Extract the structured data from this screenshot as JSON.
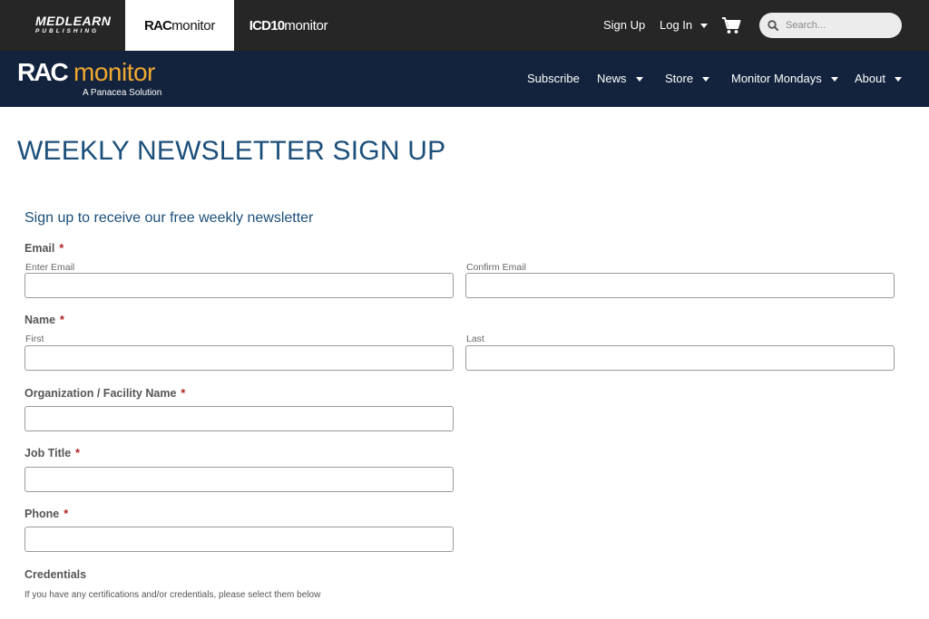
{
  "topbar": {
    "medlearn_main": "MEDLEARN",
    "medlearn_sub": "PUBLISHING",
    "tab_rac_bold": "RAC",
    "tab_rac_light": "monitor",
    "tab_icd_bold": "ICD10",
    "tab_icd_light": "monitor",
    "signup": "Sign Up",
    "login": "Log In",
    "search_placeholder": "Search..."
  },
  "nav": {
    "logo_bold": "RAC",
    "logo_light": "monitor",
    "logo_tagline": "A Panacea Solution",
    "items": [
      "Subscribe",
      "News",
      "Store",
      "Monitor Mondays",
      "About"
    ]
  },
  "page": {
    "title": "WEEKLY NEWSLETTER SIGN UP",
    "form_heading": "Sign up to receive our free weekly newsletter"
  },
  "form": {
    "email_label": "Email",
    "email_enter": "Enter Email",
    "email_confirm": "Confirm Email",
    "name_label": "Name",
    "name_first": "First",
    "name_last": "Last",
    "org_label": "Organization / Facility Name",
    "job_label": "Job Title",
    "phone_label": "Phone",
    "cred_label": "Credentials",
    "cred_help": "If you have any certifications and/or credentials, please select them below",
    "required_mark": "*"
  },
  "colors": {
    "topbar_bg": "#262626",
    "navbar_bg": "#13233d",
    "accent_orange": "#f0a830",
    "title_blue": "#1c4f7a",
    "required_red": "#b22222"
  }
}
